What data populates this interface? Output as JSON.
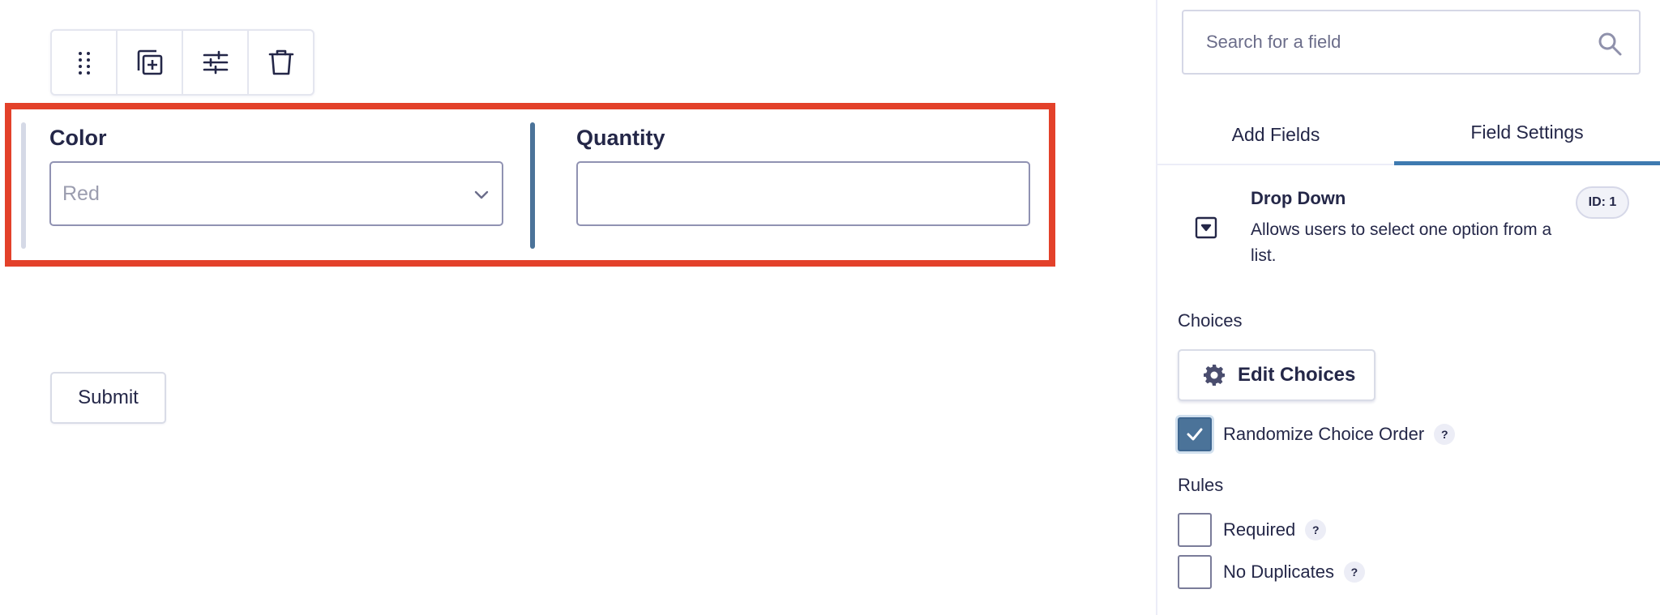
{
  "toolbar": {
    "buttons": [
      {
        "icon": "drag-handle-icon"
      },
      {
        "icon": "duplicate-icon"
      },
      {
        "icon": "settings-sliders-icon"
      },
      {
        "icon": "trash-icon"
      }
    ]
  },
  "form": {
    "fields": [
      {
        "label": "Color",
        "type": "select",
        "value": "Red"
      },
      {
        "label": "Quantity",
        "type": "text",
        "value": ""
      }
    ],
    "submit_label": "Submit"
  },
  "sidebar": {
    "search": {
      "placeholder": "Search for a field",
      "icon": "search-icon"
    },
    "tabs": [
      {
        "label": "Add Fields",
        "active": false
      },
      {
        "label": "Field Settings",
        "active": true
      }
    ],
    "field_info": {
      "title": "Drop Down",
      "description": "Allows users to select one option from a list.",
      "id_badge": "ID: 1",
      "icon": "dropdown-field-icon"
    },
    "choices": {
      "section_label": "Choices",
      "edit_button": "Edit Choices",
      "randomize": {
        "label": "Randomize Choice Order",
        "checked": true,
        "help": "?"
      }
    },
    "rules": {
      "section_label": "Rules",
      "items": [
        {
          "label": "Required",
          "checked": false,
          "help": "?"
        },
        {
          "label": "No Duplicates",
          "checked": false,
          "help": "?"
        }
      ]
    }
  },
  "colors": {
    "selection_border": "#e3412a",
    "accent": "#4b7399",
    "active_tab_underline": "#3e7ab0",
    "text": "#242748"
  }
}
